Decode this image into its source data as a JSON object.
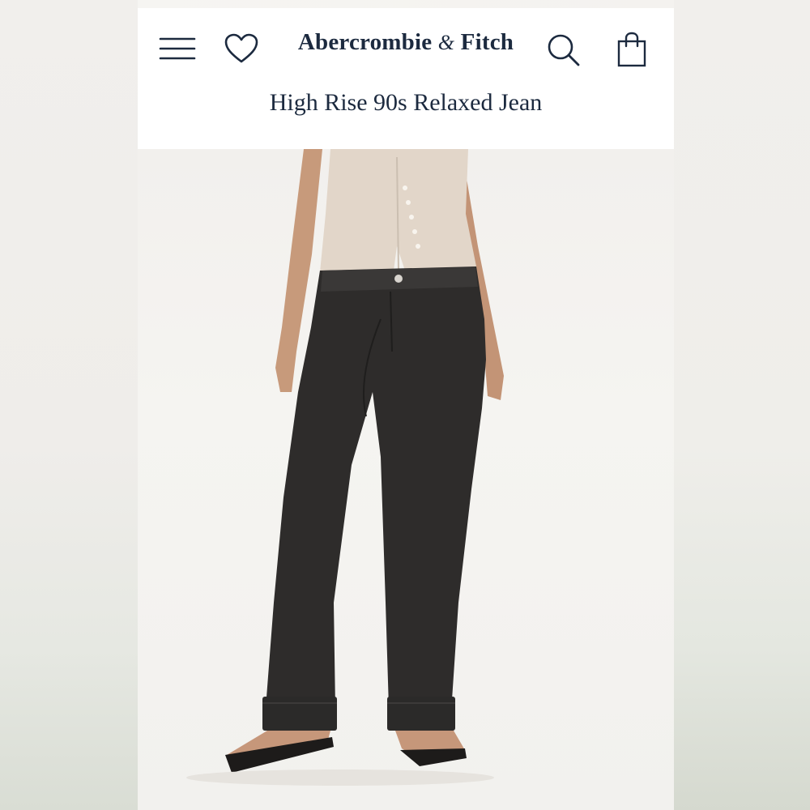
{
  "brand": {
    "logo_text_part1": "Abercrombie",
    "logo_amp": "&",
    "logo_text_part2": "Fitch"
  },
  "header": {
    "icons": [
      "menu-icon",
      "heart-icon",
      "search-icon",
      "shopping-bag-icon"
    ],
    "colors": {
      "ink": "#1c2a3f",
      "background": "#ffffff"
    }
  },
  "product": {
    "title": "High Rise 90s Relaxed Jean"
  }
}
